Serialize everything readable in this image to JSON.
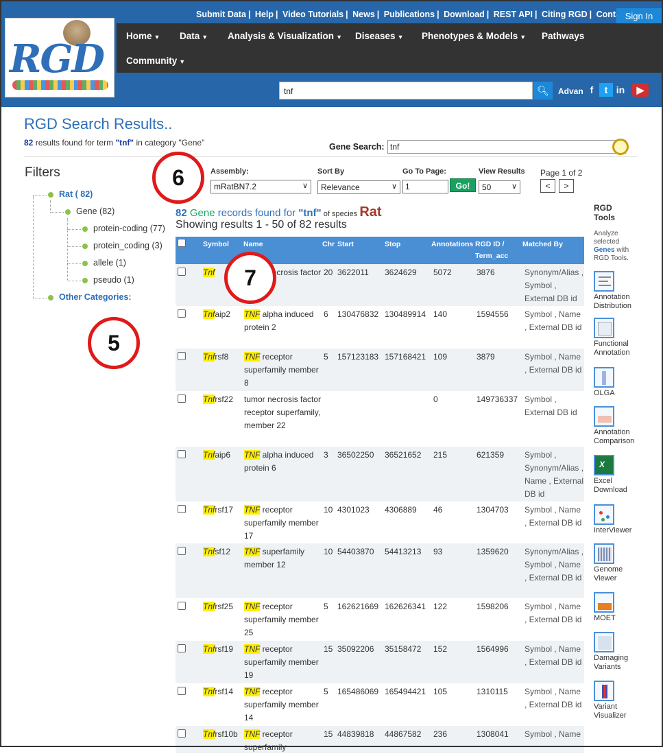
{
  "header": {
    "top_links": [
      "Submit Data",
      "Help",
      "Video Tutorials",
      "News",
      "Publications",
      "Download",
      "REST API",
      "Citing RGD",
      "Contact"
    ],
    "sign_in": "Sign In",
    "nav": [
      {
        "label": "Home",
        "has_menu": true
      },
      {
        "label": "Data",
        "has_menu": true
      },
      {
        "label": "Analysis & Visualization",
        "has_menu": true
      },
      {
        "label": "Diseases",
        "has_menu": true
      },
      {
        "label": "Phenotypes & Models",
        "has_menu": true
      },
      {
        "label": "Pathways",
        "has_menu": false
      },
      {
        "label": "Community",
        "has_menu": true
      }
    ],
    "search_value": "tnf",
    "advanced_label": "Advan",
    "logo_text": "RGD"
  },
  "page": {
    "title": "RGD Search Results..",
    "summary_count": "82",
    "summary_text1": " results found for term ",
    "summary_term": "\"tnf\"",
    "summary_text2": " in category \"Gene\"",
    "gene_search_label": "Gene Search:",
    "gene_search_value": "tnf"
  },
  "filters": {
    "title": "Filters",
    "rat": "Rat ( 82)",
    "gene": "Gene (82)",
    "leaves": [
      "protein-coding (77)",
      "protein_coding (3)",
      "allele (1)",
      "pseudo (1)"
    ],
    "other": "Other Categories:"
  },
  "annotations": {
    "five": "5",
    "six": "6",
    "seven": "7"
  },
  "controls": {
    "assembly_label": "Assembly:",
    "assembly_value": "mRatBN7.2",
    "sort_label": "Sort By",
    "sort_value": "Relevance",
    "goto_label": "Go To Page:",
    "goto_value": "1",
    "go_button": "Go!",
    "view_label": "View Results",
    "view_value": "50",
    "page_info": "Page 1 of 2",
    "prev": "<",
    "next": ">"
  },
  "records": {
    "count": "82",
    "gene_word": " Gene",
    "text1": " records found for ",
    "term": "\"tnf\"",
    "text2": " of species ",
    "species": "Rat",
    "showing": "Showing results 1 - 50 of 82 results"
  },
  "table": {
    "headers": {
      "symbol": "Symbol",
      "name": "Name",
      "chr": "Chr",
      "start": "Start",
      "stop": "Stop",
      "annotations": "Annotations",
      "rgd_id": "RGD ID /",
      "term_acc": "Term_acc",
      "matched": "Matched By"
    },
    "rows": [
      {
        "sym_hl": "Tnf",
        "sym_rest": "",
        "name_hl": "",
        "name_rest": "tumor necrosis factor",
        "chr": "20",
        "start": "3622011",
        "stop": "3624629",
        "ann": "5072",
        "rgd": "3876",
        "matched": "Synonym/Alias , Symbol , External DB id"
      },
      {
        "sym_hl": "Tnf",
        "sym_rest": "aip2",
        "name_hl": "TNF",
        "name_rest": " alpha induced protein 2",
        "chr": "6",
        "start": "130476832",
        "stop": "130489914",
        "ann": "140",
        "rgd": "1594556",
        "matched": "Symbol , Name , External DB id"
      },
      {
        "sym_hl": "Tnf",
        "sym_rest": "rsf8",
        "name_hl": "TNF",
        "name_rest": " receptor superfamily member 8",
        "chr": "5",
        "start": "157123183",
        "stop": "157168421",
        "ann": "109",
        "rgd": "3879",
        "matched": "Symbol , Name , External DB id"
      },
      {
        "sym_hl": "Tnf",
        "sym_rest": "rsf22",
        "name_hl": "",
        "name_rest": "tumor necrosis factor receptor superfamily, member 22",
        "chr": "",
        "start": "",
        "stop": "",
        "ann": "0",
        "rgd": "149736337",
        "matched": "Symbol , External DB id"
      },
      {
        "sym_hl": "Tnf",
        "sym_rest": "aip6",
        "name_hl": "TNF",
        "name_rest": " alpha induced protein 6",
        "chr": "3",
        "start": "36502250",
        "stop": "36521652",
        "ann": "215",
        "rgd": "621359",
        "matched": "Symbol , Synonym/Alias , Name , External DB id"
      },
      {
        "sym_hl": "Tnf",
        "sym_rest": "rsf17",
        "name_hl": "TNF",
        "name_rest": " receptor superfamily member 17",
        "chr": "10",
        "start": "4301023",
        "stop": "4306889",
        "ann": "46",
        "rgd": "1304703",
        "matched": "Symbol , Name , External DB id"
      },
      {
        "sym_hl": "Tnf",
        "sym_rest": "sf12",
        "name_hl": "TNF",
        "name_rest": " superfamily member 12",
        "chr": "10",
        "start": "54403870",
        "stop": "54413213",
        "ann": "93",
        "rgd": "1359620",
        "matched": "Synonym/Alias , Symbol , Name , External DB id"
      },
      {
        "sym_hl": "Tnf",
        "sym_rest": "rsf25",
        "name_hl": "TNF",
        "name_rest": " receptor superfamily member 25",
        "chr": "5",
        "start": "162621669",
        "stop": "162626341",
        "ann": "122",
        "rgd": "1598206",
        "matched": "Symbol , Name , External DB id"
      },
      {
        "sym_hl": "Tnf",
        "sym_rest": "rsf19",
        "name_hl": "TNF",
        "name_rest": " receptor superfamily member 19",
        "chr": "15",
        "start": "35092206",
        "stop": "35158472",
        "ann": "152",
        "rgd": "1564996",
        "matched": "Symbol , Name , External DB id"
      },
      {
        "sym_hl": "Tnf",
        "sym_rest": "rsf14",
        "name_hl": "TNF",
        "name_rest": " receptor superfamily member 14",
        "chr": "5",
        "start": "165486069",
        "stop": "165494421",
        "ann": "105",
        "rgd": "1310115",
        "matched": "Symbol , Name , External DB id"
      },
      {
        "sym_hl": "Tnf",
        "sym_rest": "rsf10b",
        "name_hl": "TNF",
        "name_rest": " receptor superfamily",
        "chr": "15",
        "start": "44839818",
        "stop": "44867582",
        "ann": "236",
        "rgd": "1308041",
        "matched": "Symbol , Name"
      }
    ]
  },
  "tools": {
    "title": "RGD Tools",
    "desc1": "Analyze selected ",
    "desc_link": "Genes",
    "desc2": " with RGD Tools.",
    "items": [
      "Annotation Distribution",
      "Functional Annotation",
      "OLGA",
      "Annotation Comparison",
      "Excel Download",
      "InterViewer",
      "Genome Viewer",
      "MOET",
      "Damaging Variants",
      "Variant Visualizer"
    ]
  },
  "colors": {
    "header_blue": "#2767a9",
    "nav_dark": "#333333",
    "link_blue": "#2e6fb8",
    "table_head": "#4a8ed4",
    "highlight": "#ffee00",
    "annotation_red": "#e01a1a"
  }
}
